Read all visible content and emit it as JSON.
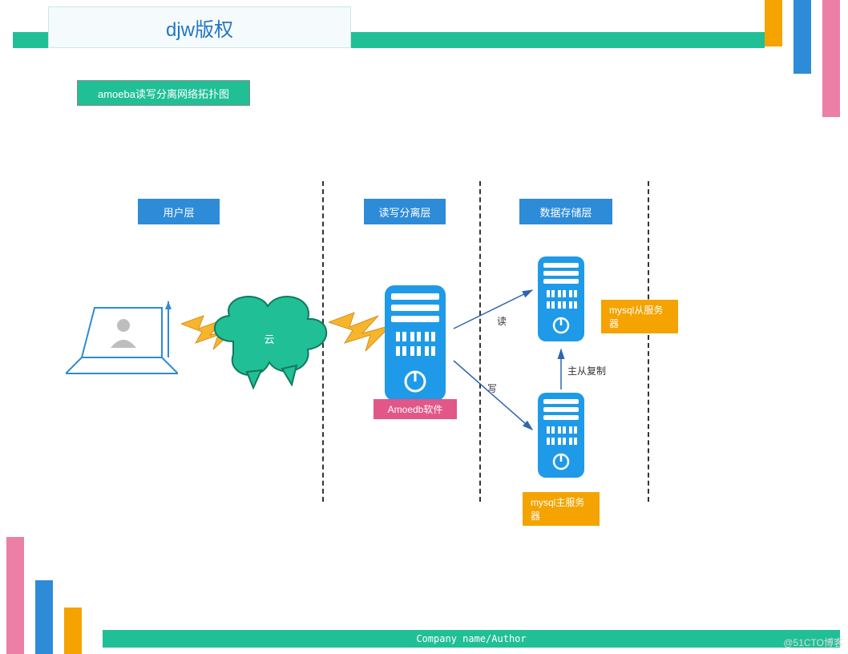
{
  "header": {
    "copyright": "djw版权",
    "subtitle": "amoeba读写分离网络拓扑图"
  },
  "layers": {
    "user": "用户层",
    "rw": "读写分离层",
    "storage": "数据存储层"
  },
  "nodes": {
    "cloud": "云",
    "amoeba": "Amoedb软件",
    "mysqlSlave": "mysql从服务器",
    "mysqlMaster": "mysql主服务器"
  },
  "edges": {
    "read": "读",
    "write": "写",
    "replicate": "主从复制"
  },
  "footer": "Company name/Author",
  "watermark": "@51CTO博客"
}
